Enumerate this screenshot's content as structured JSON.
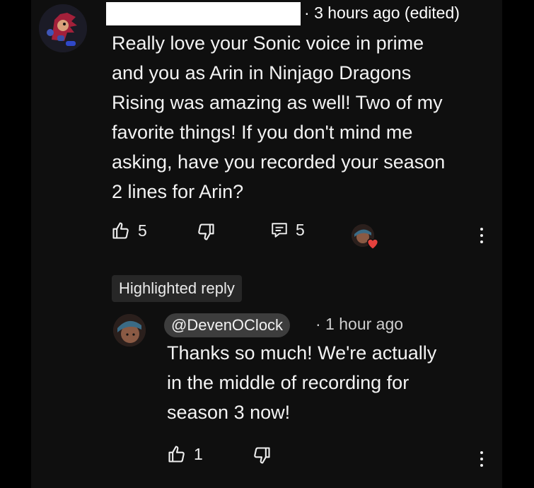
{
  "comment": {
    "author_redacted": "",
    "timestamp": "3 hours ago (edited)",
    "text_lines": [
      "Really love your Sonic voice in prime",
      "and you as Arin in Ninjago Dragons",
      "Rising was amazing as well! Two of my",
      "favorite things! If you don't mind me",
      "asking, have you recorded your season",
      "2 lines for Arin?"
    ],
    "like_count": "5",
    "reply_count": "5",
    "icons": {
      "like": "thumbs-up-icon",
      "dislike": "thumbs-down-icon",
      "reply": "reply-icon",
      "more": "more-vert-icon",
      "creator_heart": "heart-icon"
    }
  },
  "highlighted_label": "Highlighted reply",
  "reply": {
    "author_handle": "@DevenOClock",
    "timestamp": "· 1 hour ago",
    "text_lines": [
      "Thanks so much! We're actually",
      "in the middle of recording for",
      "season 3 now!"
    ],
    "like_count": "1"
  },
  "colors": {
    "background": "#0f0f0f",
    "text": "#f1f1f1",
    "chip": "#272727",
    "heart": "#e5413d"
  }
}
